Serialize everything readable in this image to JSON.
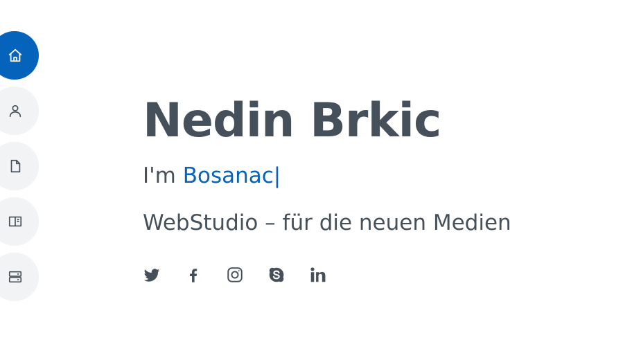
{
  "nav": {
    "items": [
      {
        "icon": "home-icon",
        "active": true
      },
      {
        "icon": "user-icon",
        "active": false
      },
      {
        "icon": "file-icon",
        "active": false
      },
      {
        "icon": "book-icon",
        "active": false
      },
      {
        "icon": "server-icon",
        "active": false
      }
    ]
  },
  "hero": {
    "name": "Nedin Brkic",
    "typed_prefix": "I'm ",
    "typed_word": "Bosanac",
    "typed_cursor": "|",
    "tagline": "WebStudio – für die neuen Medien"
  },
  "social": [
    "twitter-icon",
    "facebook-icon",
    "instagram-icon",
    "skype-icon",
    "linkedin-icon"
  ],
  "colors": {
    "accent": "#0563bb",
    "text": "#45505b",
    "nav_bg": "#f2f3f5"
  }
}
